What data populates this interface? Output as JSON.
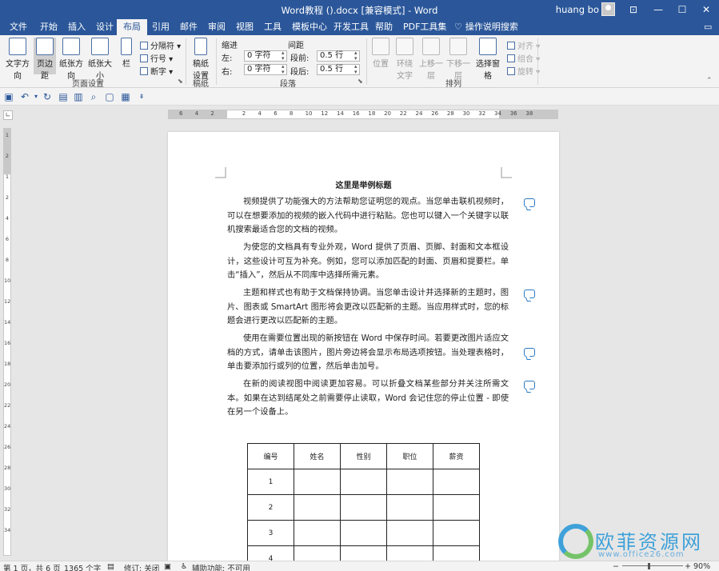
{
  "window": {
    "title": "Word教程 ().docx [兼容模式] - Word",
    "user": "huang bo",
    "controls": [
      "⊡",
      "—",
      "☐",
      "✕"
    ]
  },
  "tabs": [
    {
      "label": "文件"
    },
    {
      "label": "开始"
    },
    {
      "label": "插入"
    },
    {
      "label": "设计"
    },
    {
      "label": "布局"
    },
    {
      "label": "引用"
    },
    {
      "label": "邮件"
    },
    {
      "label": "审阅"
    },
    {
      "label": "视图"
    },
    {
      "label": "工具"
    },
    {
      "label": "模板中心"
    },
    {
      "label": "开发工具"
    },
    {
      "label": "帮助"
    },
    {
      "label": "PDF工具集"
    },
    {
      "label": "操作说明搜索"
    }
  ],
  "ribbon": {
    "page_setup": {
      "text_direction": "文字方向",
      "margins": "页边距",
      "orientation": "纸张方向",
      "size": "纸张大小",
      "columns": "栏",
      "breaks": "分隔符",
      "line_numbers": "行号",
      "hyphenation": "断字",
      "group_label": "页面设置"
    },
    "draft": {
      "draft_paper": "稿纸设置",
      "group_label": "稿纸"
    },
    "paragraph": {
      "indent_header": "缩进",
      "spacing_header": "间距",
      "left_label": "左:",
      "left_value": "0 字符",
      "right_label": "右:",
      "right_value": "0 字符",
      "before_label": "段前:",
      "before_value": "0.5 行",
      "after_label": "段后:",
      "after_value": "0.5 行",
      "group_label": "段落"
    },
    "arrange": {
      "position": "位置",
      "wrap_text": "环绕文字",
      "bring_forward": "上移一层",
      "send_backward": "下移一层",
      "selection_pane": "选择窗格",
      "align": "对齐",
      "group": "组合",
      "rotate": "旋转",
      "group_label": "排列"
    }
  },
  "ruler": {
    "h_numbers": [
      "6",
      "4",
      "2",
      "",
      "2",
      "4",
      "6",
      "8",
      "10",
      "12",
      "14",
      "16",
      "18",
      "20",
      "22",
      "24",
      "26",
      "28",
      "30",
      "32",
      "34",
      "36",
      "38"
    ],
    "v_numbers": [
      "1",
      "2",
      "1",
      "2",
      "4",
      "6",
      "8",
      "10",
      "12",
      "14",
      "16",
      "18",
      "20",
      "22",
      "24",
      "26",
      "28",
      "30",
      "32",
      "34"
    ]
  },
  "document": {
    "title": "这里是举例标题",
    "paragraphs": [
      "视频提供了功能强大的方法帮助您证明您的观点。当您单击联机视频时，可以在想要添加的视频的嵌入代码中进行粘贴。您也可以键入一个关键字以联机搜索最适合您的文档的视频。",
      "为使您的文档具有专业外观，Word 提供了页眉、页脚、封面和文本框设计，这些设计可互为补充。例如，您可以添加匹配的封面、页眉和提要栏。单击“插入”，然后从不同库中选择所需元素。",
      "主题和样式也有助于文档保持协调。当您单击设计并选择新的主题时，图片、图表或 SmartArt 图形将会更改以匹配新的主题。当应用样式时，您的标题会进行更改以匹配新的主题。",
      "使用在需要位置出现的新按钮在 Word 中保存时间。若要更改图片适应文档的方式，请单击该图片，图片旁边将会显示布局选项按钮。当处理表格时，单击要添加行或列的位置，然后单击加号。",
      "在新的阅读视图中阅读更加容易。可以折叠文档某些部分并关注所需文本。如果在达到结尾处之前需要停止读取，Word 会记住您的停止位置 - 即使在另一个设备上。"
    ],
    "table": {
      "headers": [
        "编号",
        "姓名",
        "性别",
        "职位",
        "薪资"
      ],
      "rows": [
        [
          "1",
          "",
          "",
          "",
          ""
        ],
        [
          "2",
          "",
          "",
          "",
          ""
        ],
        [
          "3",
          "",
          "",
          "",
          ""
        ],
        [
          "4",
          "",
          "",
          "",
          ""
        ]
      ]
    }
  },
  "status": {
    "page": "第 1 页，共 6 页",
    "words": "1365 个字",
    "revision": "修订: 关闭",
    "accessibility": "辅助功能: 不可用",
    "zoom": "90%"
  },
  "watermark": {
    "brand": "欧菲资源网",
    "url": "www.office26.com"
  },
  "colors": {
    "accent": "#2b579a",
    "comment": "#2b79c2"
  }
}
